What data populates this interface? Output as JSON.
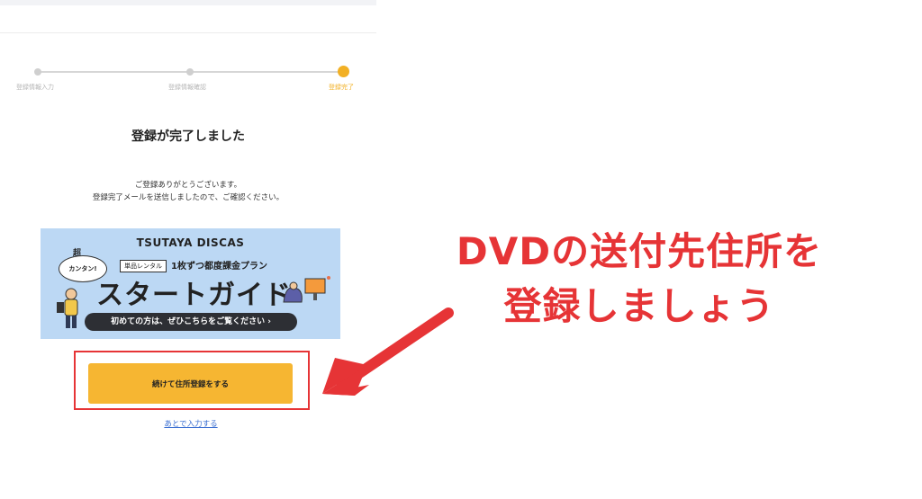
{
  "stepper": {
    "steps": [
      {
        "label": "登録情報入力",
        "state": "done"
      },
      {
        "label": "登録情報確認",
        "state": "done"
      },
      {
        "label": "登録完了",
        "state": "active"
      }
    ],
    "colors": {
      "active": "#f2b024",
      "inactive": "#cfcfcf"
    }
  },
  "page_title": "登録が完了しました",
  "message": {
    "line1": "ご登録ありがとうございます。",
    "line2": "登録完了メールを送信しましたので、ご確認ください。"
  },
  "banner": {
    "brand": "TSUTAYA DISCAS",
    "bubble_top": "超",
    "bubble": "カンタン!",
    "tag": "単品レンタル",
    "plan": "1枚ずつ都度課金プラン",
    "main": "スタートガイド",
    "pill": "初めての方は、ぜひこちらをご覧ください ›"
  },
  "cta": {
    "continue_label": "続けて住所登録をする",
    "later_label": "あとで入力する",
    "button_color": "#f6b632",
    "frame_color": "#e63436"
  },
  "annotation": {
    "line1": "DVDの送付先住所を",
    "line2": "登録しましょう",
    "color": "#e63436"
  }
}
